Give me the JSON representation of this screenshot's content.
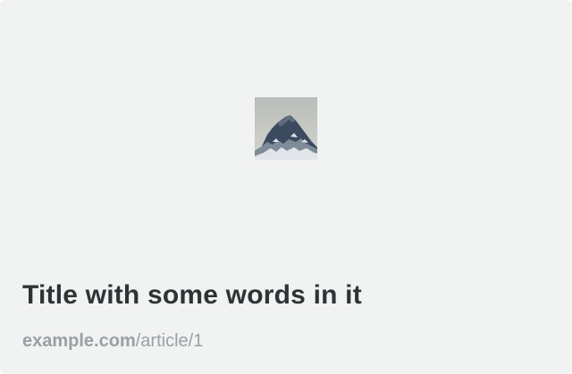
{
  "card": {
    "image": {
      "icon": "mountain-peak-image",
      "colors": {
        "sky": "#c6c8c4",
        "rock": "#3c4a5f",
        "snow": "#e6e9ec"
      }
    },
    "title": "Title with some words in it",
    "url": {
      "domain": "example.com",
      "path": "/article/1"
    },
    "colors": {
      "background": "#f1f2f2",
      "title": "#2f3336",
      "url": "#9aa0a5"
    }
  }
}
